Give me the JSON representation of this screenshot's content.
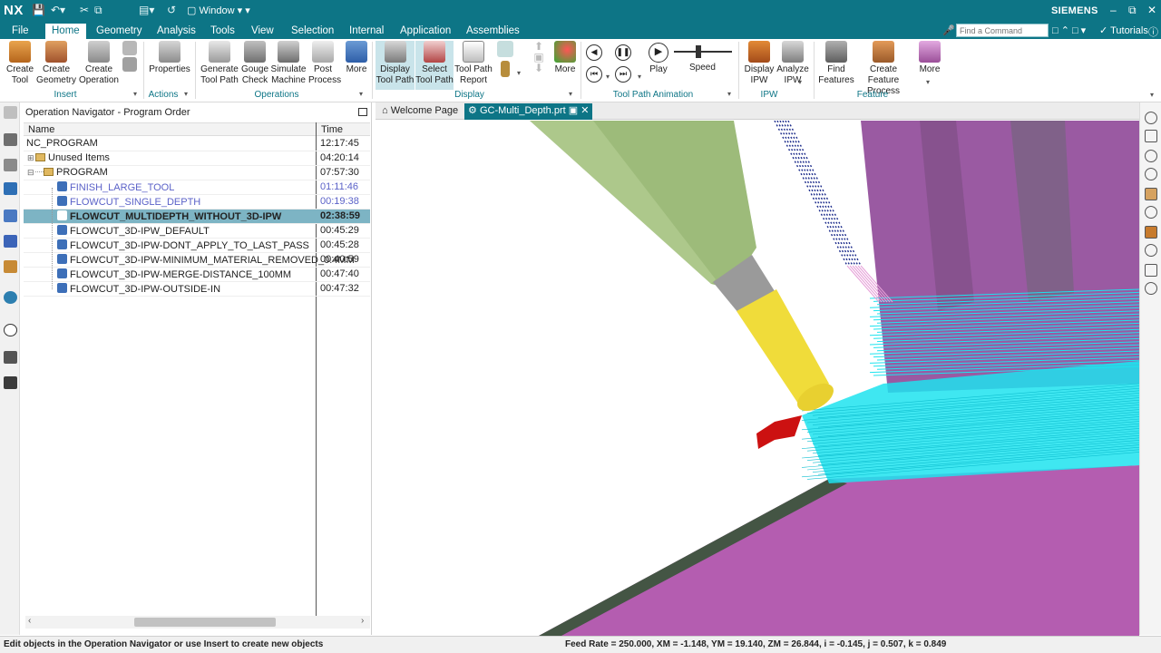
{
  "titlebar": {
    "app": "NX",
    "window_menu": "Window",
    "brand": "SIEMENS"
  },
  "menu": {
    "tabs": [
      "File",
      "Home",
      "Geometry",
      "Analysis",
      "Tools",
      "View",
      "Selection",
      "Internal",
      "Application",
      "Assemblies"
    ],
    "active": "Home",
    "find_placeholder": "Find a Command",
    "tutorials": "Tutorials"
  },
  "ribbon": {
    "buttons": {
      "create_tool": "Create\nTool",
      "create_geometry": "Create\nGeometry",
      "create_operation": "Create\nOperation",
      "properties": "Properties",
      "generate_tool_path": "Generate\nTool Path",
      "gouge_check": "Gouge\nCheck",
      "simulate_machine": "Simulate\nMachine",
      "post_process": "Post\nProcess",
      "more_ops": "More",
      "display_tool_path": "Display\nTool Path",
      "select_tool_path": "Select\nTool Path",
      "tool_path_report": "Tool Path\nReport",
      "more_display": "More",
      "play": "Play",
      "speed": "Speed",
      "display_ipw": "Display\nIPW",
      "analyze_ipw": "Analyze\nIPW",
      "find_features": "Find\nFeatures",
      "create_feature_process": "Create Feature\nProcess",
      "more_feature": "More"
    },
    "groups": {
      "insert": "Insert",
      "actions": "Actions",
      "operations": "Operations",
      "display": "Display",
      "animation": "Tool Path Animation",
      "ipw": "IPW",
      "feature": "Feature"
    }
  },
  "navigator": {
    "title": "Operation Navigator - Program Order",
    "col_name": "Name",
    "col_time": "Time",
    "rows": [
      {
        "name": "NC_PROGRAM",
        "time": "12:17:45"
      },
      {
        "name": "Unused Items",
        "time": "04:20:14"
      },
      {
        "name": "PROGRAM",
        "time": "07:57:30"
      },
      {
        "name": "FINISH_LARGE_TOOL",
        "time": "01:11:46"
      },
      {
        "name": "FLOWCUT_SINGLE_DEPTH",
        "time": "00:19:38"
      },
      {
        "name": "FLOWCUT_MULTIDEPTH_WITHOUT_3D-IPW",
        "time": "02:38:59"
      },
      {
        "name": "FLOWCUT_3D-IPW_DEFAULT",
        "time": "00:45:29"
      },
      {
        "name": "FLOWCUT_3D-IPW-DONT_APPLY_TO_LAST_PASS",
        "time": "00:45:28"
      },
      {
        "name": "FLOWCUT_3D-IPW-MINIMUM_MATERIAL_REMOVED_0.4MM",
        "time": "00:40:59"
      },
      {
        "name": "FLOWCUT_3D-IPW-MERGE-DISTANCE_100MM",
        "time": "00:47:40"
      },
      {
        "name": "FLOWCUT_3D-IPW-OUTSIDE-IN",
        "time": "00:47:32"
      }
    ]
  },
  "doc_tabs": {
    "welcome": "Welcome Page",
    "part": "GC-Multi_Depth.prt"
  },
  "status": {
    "left": "Edit objects in the Operation Navigator or use Insert to create new objects",
    "right": "Feed Rate = 250.000, XM = -1.148, YM = 19.140, ZM = 26.844, i = -0.145, j = 0.507, k = 0.849"
  },
  "colors": {
    "accent": "#0d7586",
    "toolpath": "#1de3ee",
    "part": "#b45db0",
    "tool_holder": "#9dbb7a",
    "tool_tip": "#f0dc3a",
    "arrow": "#cc1111"
  }
}
